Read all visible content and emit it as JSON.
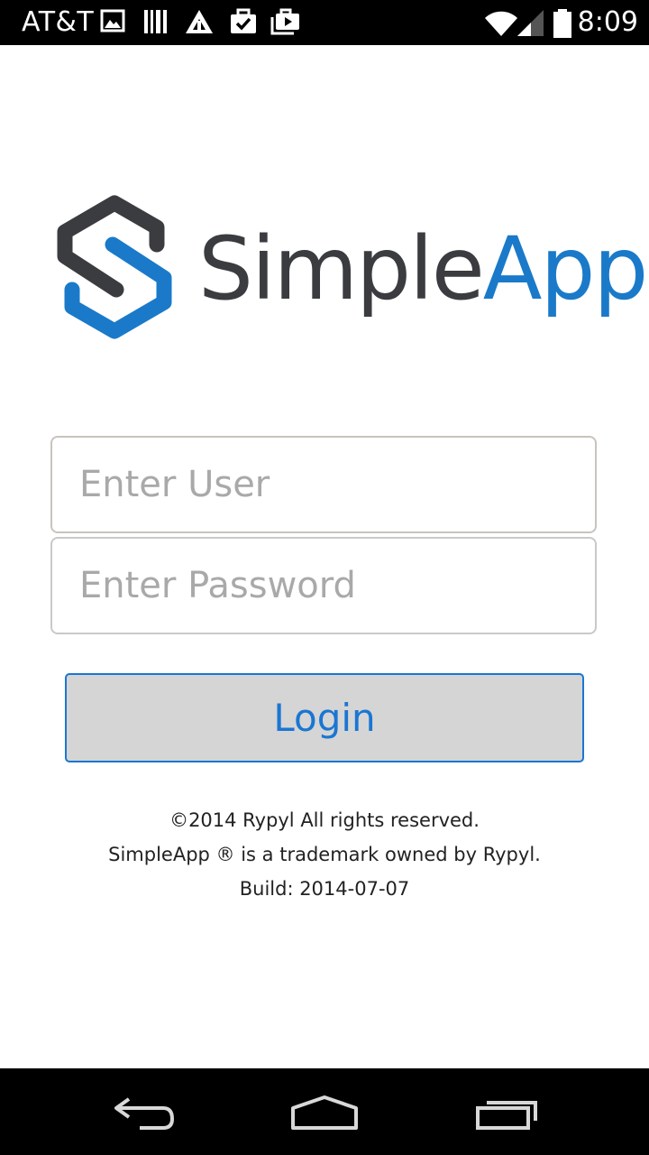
{
  "status_bar": {
    "carrier": "AT&T",
    "time": "8:09"
  },
  "logo": {
    "word_simple": "Simple",
    "word_app": "App",
    "colors": {
      "dark": "#3b3c40",
      "blue": "#1a7ac9"
    }
  },
  "form": {
    "user_placeholder": "Enter User",
    "password_placeholder": "Enter Password",
    "login_label": "Login"
  },
  "footer": {
    "copyright": "©2014 Rypyl All rights reserved.",
    "trademark": "SimpleApp ® is a trademark owned by Rypyl.",
    "build": "Build: 2014-07-07"
  },
  "icons": {
    "status": [
      "image-icon",
      "barcode-icon",
      "triangle-logo-icon",
      "briefcase-check-icon",
      "briefcase-play-icon",
      "wifi-icon",
      "signal-icon",
      "battery-icon"
    ],
    "nav": [
      "back-icon",
      "home-icon",
      "recent-apps-icon"
    ]
  },
  "accent_color": "#1a76d2"
}
